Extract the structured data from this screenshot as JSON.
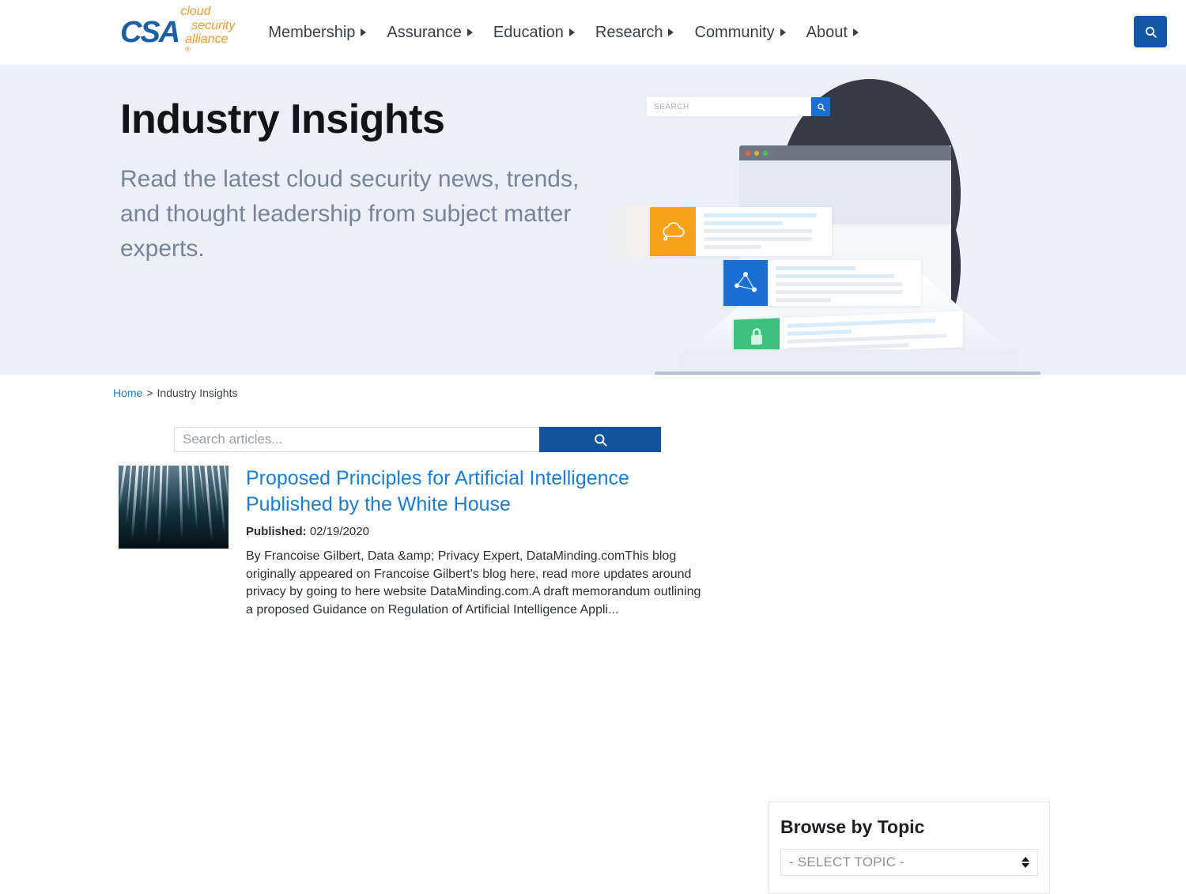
{
  "header": {
    "logo": {
      "mark": "CSA",
      "line1": "cloud",
      "line2": "security",
      "line3": "alliance",
      "trademark": "®"
    },
    "nav": [
      {
        "label": "Membership"
      },
      {
        "label": "Assurance"
      },
      {
        "label": "Education"
      },
      {
        "label": "Research"
      },
      {
        "label": "Community"
      },
      {
        "label": "About"
      }
    ],
    "search_button_icon": "search-icon"
  },
  "hero": {
    "title": "Industry Insights",
    "subtitle": "Read the latest cloud security news, trends, and thought leadership from subject matter experts.",
    "illustration": {
      "browser_search_placeholder": "SEARCH",
      "cards": [
        {
          "icon": "cloud-icon",
          "color": "#f9a11b"
        },
        {
          "icon": "network-nodes-icon",
          "color": "#1a6fd4"
        },
        {
          "icon": "lock-icon",
          "color": "#3ec17e"
        }
      ]
    }
  },
  "breadcrumb": {
    "home": "Home",
    "separator": ">",
    "current": "Industry Insights"
  },
  "search": {
    "placeholder": "Search articles...",
    "value": "",
    "button_icon": "search-icon"
  },
  "articles": [
    {
      "title": "Proposed Principles for Artificial Intelligence Published by the White House",
      "published_label": "Published:",
      "published_date": "02/19/2020",
      "excerpt": "By Francoise Gilbert, Data &amp; Privacy Expert, DataMinding.comThis blog originally appeared on Francoise Gilbert's blog here, read more updates around privacy by going to here website DataMinding.com.A draft memorandum outlining a proposed Guidance on Regulation of Artificial Intelligence Appli..."
    }
  ],
  "sidebar": {
    "title": "Browse by Topic",
    "topic_select_value": "- SELECT TOPIC -"
  },
  "colors": {
    "brand_blue": "#1b5faa",
    "brand_orange": "#f0992c",
    "link_blue": "#1a7fd4",
    "button_blue": "#14539d",
    "hero_bg": "#eceff5"
  }
}
